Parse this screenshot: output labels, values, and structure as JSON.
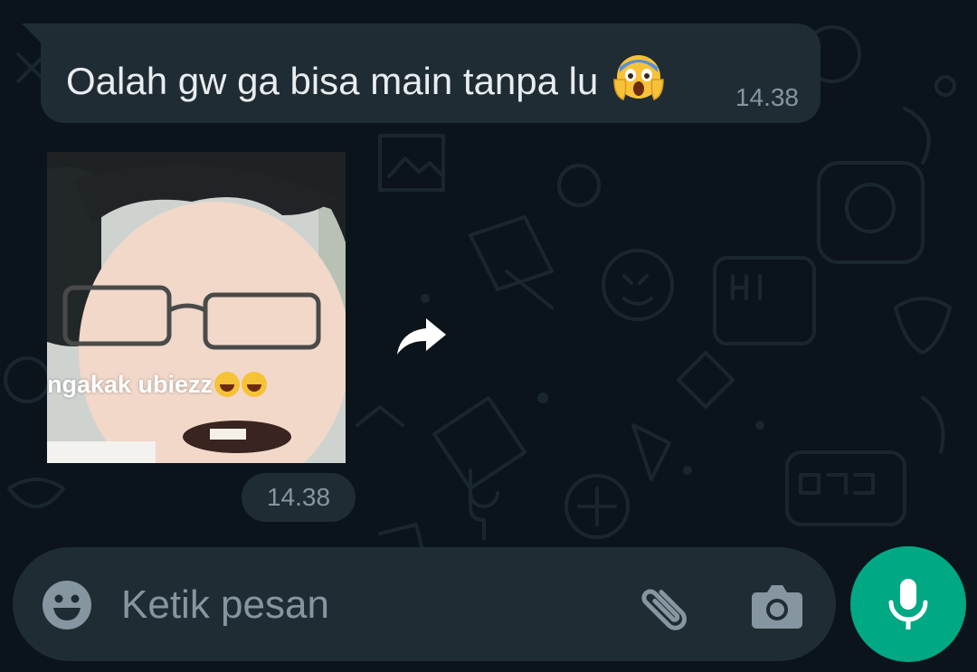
{
  "messages": [
    {
      "type": "text",
      "direction": "incoming",
      "text": "Oalah gw ga bisa main tanpa lu",
      "emoji": "face-screaming-in-fear",
      "time": "14.38"
    },
    {
      "type": "sticker",
      "direction": "incoming",
      "caption": "ngakak ubiezz",
      "caption_emojis": [
        "rolling-on-floor-laughing",
        "face-with-tears-of-joy"
      ],
      "time": "14.38"
    }
  ],
  "composer": {
    "placeholder": "Ketik pesan",
    "icons": [
      "emoji-icon",
      "paperclip-icon",
      "camera-icon",
      "microphone-icon"
    ]
  },
  "colors": {
    "background": "#0b141a",
    "bubble": "#1f2c34",
    "text_primary": "#e9edef",
    "text_secondary": "#8696a0",
    "accent": "#00a884"
  }
}
